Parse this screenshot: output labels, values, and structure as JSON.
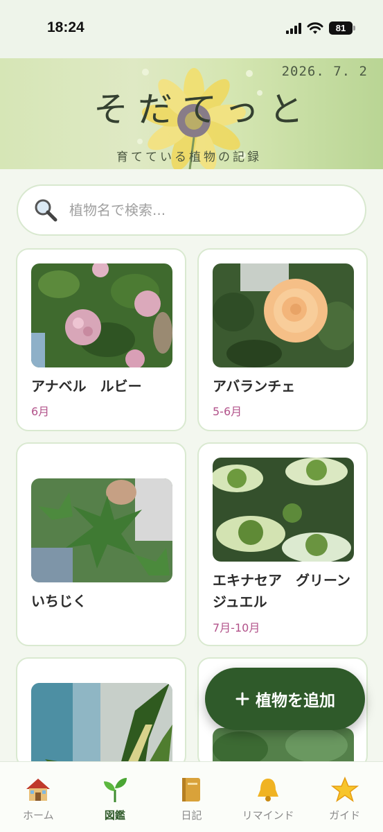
{
  "status_bar": {
    "time": "18:24",
    "battery": "81"
  },
  "header": {
    "date": "2026.  7.  2",
    "title": "そだてっと",
    "subtitle": "育てている植物の記録"
  },
  "search": {
    "placeholder": "植物名で検索..."
  },
  "plants": [
    {
      "name": "アナベル　ルビー",
      "season": "6月"
    },
    {
      "name": "アバランチェ",
      "season": "5-6月"
    },
    {
      "name": "いちじく",
      "season": ""
    },
    {
      "name": "エキナセア　グリーンジュエル",
      "season": "7月-10月"
    }
  ],
  "fab": {
    "label": "植物を追加",
    "icon": "plus-icon"
  },
  "nav": [
    {
      "label": "ホーム",
      "icon": "house-icon"
    },
    {
      "label": "図鑑",
      "icon": "seedling-icon"
    },
    {
      "label": "日記",
      "icon": "notebook-icon"
    },
    {
      "label": "リマインド",
      "icon": "bell-icon"
    },
    {
      "label": "ガイド",
      "icon": "star-icon"
    }
  ],
  "colors": {
    "accent": "#2f5a2a",
    "season_text": "#b2528a",
    "card_border": "#d9e9d0",
    "background": "#f3f7ef"
  }
}
